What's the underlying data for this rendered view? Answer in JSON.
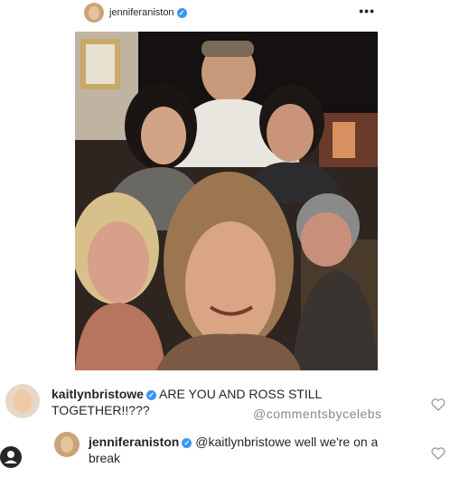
{
  "post": {
    "username": "jenniferaniston",
    "more_label": "•••"
  },
  "comments": [
    {
      "username": "kaitlynbristowe",
      "text": "ARE YOU AND ROSS STILL TOGETHER!!???"
    },
    {
      "username": "jenniferaniston",
      "mention": "@kaitlynbristowe",
      "text": " well we're on a break"
    }
  ],
  "watermark": "@commentsbycelebs",
  "colors": {
    "verified": "#3897f0",
    "text": "#262626"
  },
  "icons": [
    "verified-icon",
    "more-icon",
    "heart-icon",
    "profile-icon"
  ]
}
